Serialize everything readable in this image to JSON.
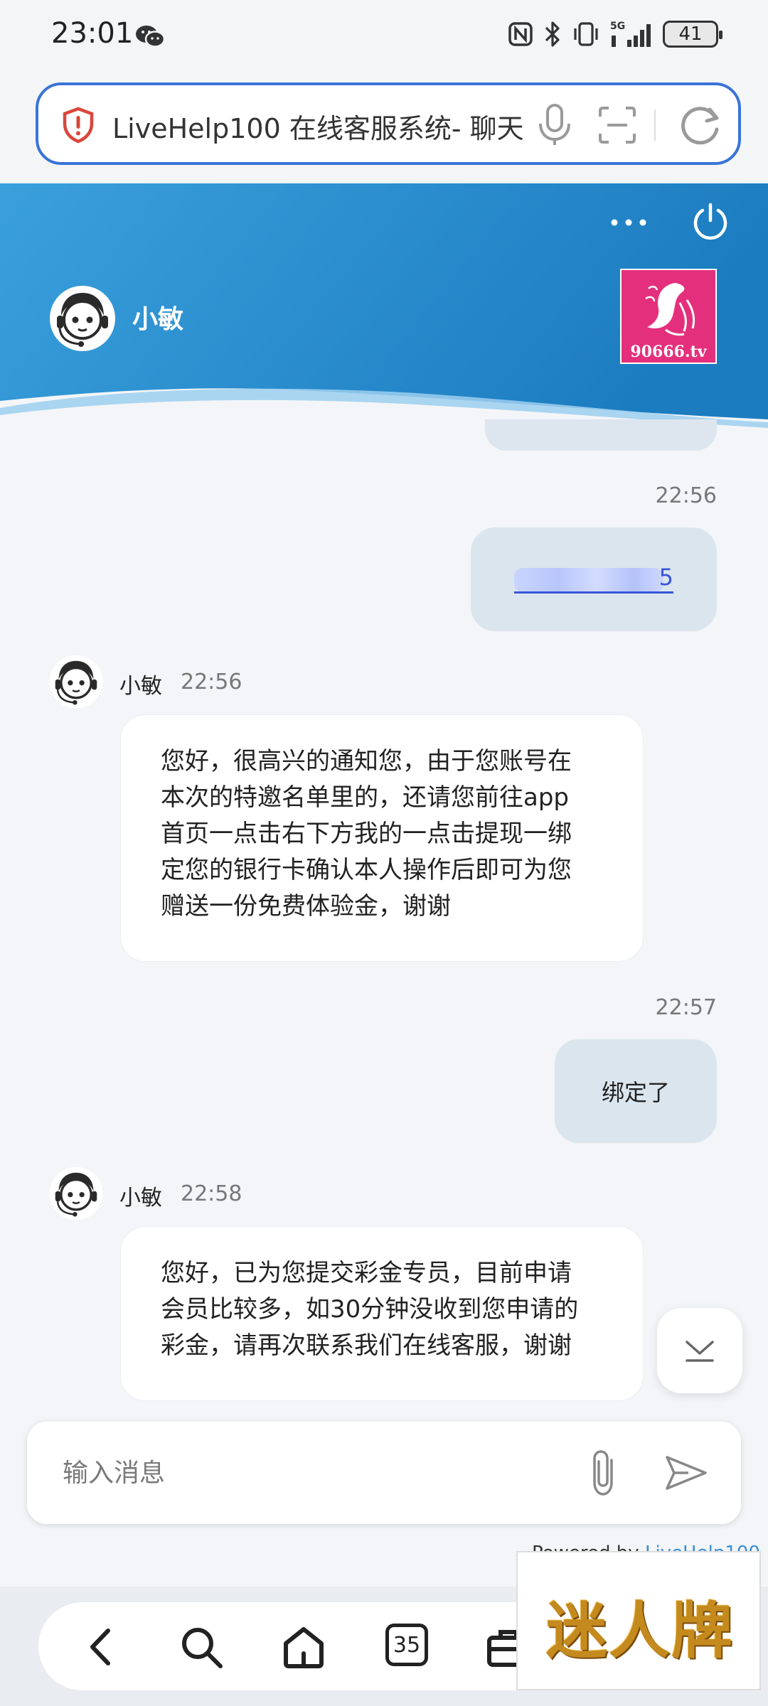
{
  "status_bar": {
    "time": "23:01",
    "network_label": "5G",
    "battery": "41"
  },
  "browser": {
    "address_text": "LiveHelp100 在线客服系统- 聊天"
  },
  "chat_header": {
    "agent_name": "小敏",
    "logo_text": "90666.tv",
    "colors": {
      "header_top": "#1e7fc2",
      "header_light": "#3aa0dc"
    }
  },
  "messages": [
    {
      "side": "right",
      "time": "22:56",
      "masked_suffix": "5"
    },
    {
      "side": "left",
      "sender": "小敏",
      "time": "22:56",
      "lines": [
        "您好，很高兴的通知您，由于您账号在",
        "本次的特邀名单里的，还请您前往app",
        "首页一点击右下方我的一点击提现一绑",
        "定您的银行卡确认本人操作后即可为您",
        "赠送一份免费体验金，谢谢"
      ]
    },
    {
      "side": "right",
      "time": "22:57",
      "text": "绑定了"
    },
    {
      "side": "left",
      "sender": "小敏",
      "time": "22:58",
      "lines": [
        "您好，已为您提交彩金专员，目前申请",
        "会员比较多，如30分钟没收到您申请的",
        "彩金，请再次联系我们在线客服，谢谢"
      ]
    }
  ],
  "input": {
    "placeholder": "输入消息"
  },
  "footer": {
    "powered_prefix": "Powered by ",
    "powered_link": "LiveHelp100"
  },
  "bottom_nav": {
    "tab_count": "35"
  },
  "watermark": {
    "text": "迷人牌"
  }
}
